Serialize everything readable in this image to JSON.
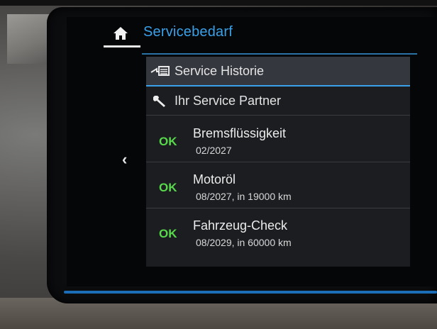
{
  "header": {
    "title": "Servicebedarf"
  },
  "menu": {
    "history_label": "Service Historie",
    "partner_label": "Ihr Service Partner"
  },
  "services": [
    {
      "status": "OK",
      "name": "Bremsflüssigkeit",
      "detail": "02/2027"
    },
    {
      "status": "OK",
      "name": "Motoröl",
      "detail": "08/2027, in 19000 km"
    },
    {
      "status": "OK",
      "name": "Fahrzeug-Check",
      "detail": "08/2029, in 60000 km"
    }
  ],
  "icons": {
    "home": "home-icon",
    "history": "service-history-icon",
    "partner": "wrench-icon",
    "back": "chevron-left-icon"
  },
  "colors": {
    "accent": "#3aa0e8",
    "ok": "#57d94b",
    "selected_bg": "#34383e"
  }
}
